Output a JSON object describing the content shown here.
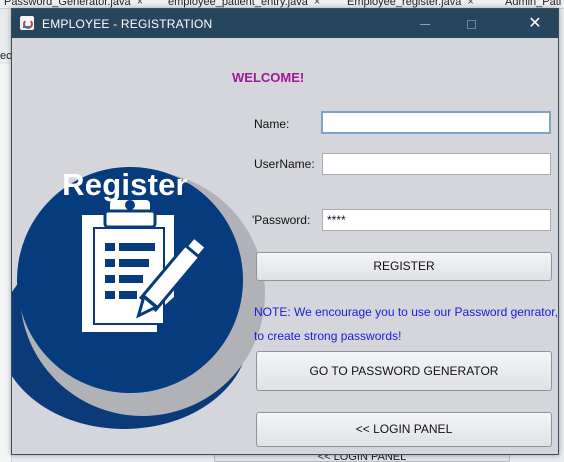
{
  "ide": {
    "tabs": [
      {
        "label": "Password_Generator.java",
        "close": "×"
      },
      {
        "label": "employee_patient_entry.java",
        "close": "×"
      },
      {
        "label": "Employee_register.java",
        "close": "×"
      },
      {
        "label": "Admin_Pati"
      }
    ],
    "left_text": "ect",
    "bottom_button": "<< LOGIN PANEL"
  },
  "window": {
    "title": "EMPLOYEE - REGISTRATION",
    "controls": {
      "minimize": "",
      "maximize": "",
      "close": "✕"
    }
  },
  "illustration": {
    "label": "Register",
    "icon": "clipboard-pencil-icon",
    "colors": {
      "circle": "#063b7e",
      "accent_text": "#ffffff"
    }
  },
  "form": {
    "welcome": "WELCOME!",
    "name_label": "Name:",
    "name_value": "",
    "username_label": "UserName:",
    "username_value": "",
    "password_label": "'Password:",
    "password_value": "****",
    "register_button": "REGISTER",
    "note_line1": "NOTE: We encourage you to use our Password genrator,",
    "note_line2": "to create strong passwords!",
    "generator_button": "GO TO PASSWORD GENERATOR",
    "login_button": "<<  LOGIN PANEL"
  },
  "colors": {
    "titlebar": "#27455c",
    "welcome": "#a0159a",
    "note": "#1a1ad6",
    "window_bg": "#d4d6dc"
  }
}
